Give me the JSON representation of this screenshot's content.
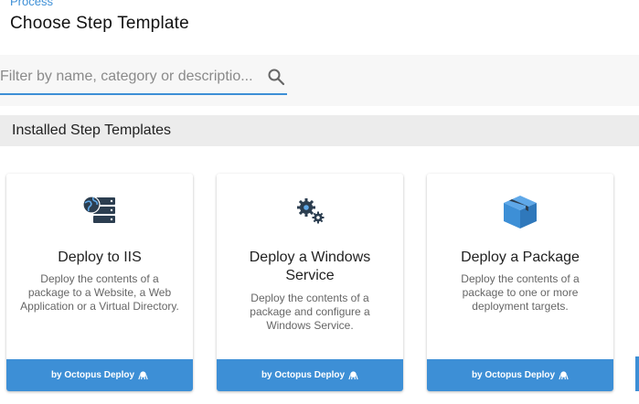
{
  "header": {
    "breadcrumb": "Process",
    "title": "Choose Step Template"
  },
  "filter": {
    "placeholder": "Filter by name, category or descriptio..."
  },
  "section": {
    "title": "Installed Step Templates"
  },
  "cards": [
    {
      "title": "Deploy to IIS",
      "description": "Deploy the contents of a package to a Website, a Web Application or a Virtual Directory.",
      "footer": "by Octopus Deploy",
      "icon": "iis-server-icon"
    },
    {
      "title": "Deploy a Windows Service",
      "description": "Deploy the contents of a package and configure a Windows Service.",
      "footer": "by Octopus Deploy",
      "icon": "gears-icon"
    },
    {
      "title": "Deploy a Package",
      "description": "Deploy the contents of a package to one or more deployment targets.",
      "footer": "by Octopus Deploy",
      "icon": "package-box-icon"
    }
  ],
  "colors": {
    "accent": "#3d8fd6",
    "highlight": "#f8f800",
    "icon_dark": "#2c3e50"
  }
}
